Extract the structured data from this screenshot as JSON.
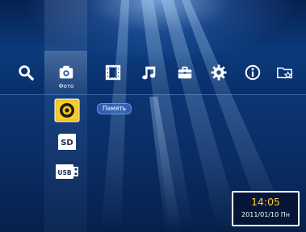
{
  "menu": {
    "items": [
      {
        "icon": "search-icon"
      },
      {
        "icon": "camera-icon",
        "label": "Фото",
        "selected": true
      },
      {
        "icon": "film-icon"
      },
      {
        "icon": "music-icon"
      },
      {
        "icon": "briefcase-icon"
      },
      {
        "icon": "gear-icon"
      },
      {
        "icon": "info-icon"
      },
      {
        "icon": "favorite-folder-icon"
      }
    ]
  },
  "storage": {
    "items": [
      {
        "icon": "internal-memory-icon",
        "selected": true
      },
      {
        "icon": "sd-card-icon",
        "text": "SD"
      },
      {
        "icon": "usb-drive-icon",
        "text": "USB"
      }
    ],
    "selected_label": "Память"
  },
  "clock": {
    "time": "14:05",
    "date": "2011/01/10 Пн"
  },
  "colors": {
    "accent_yellow": "#ffce2e",
    "background": "#0b3a7c"
  }
}
